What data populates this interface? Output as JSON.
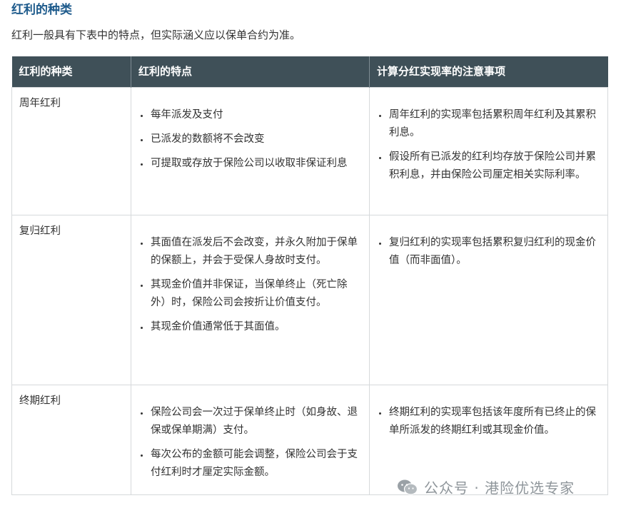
{
  "section_title": "红利的种类",
  "intro": "红利一般具有下表中的特点，但实际涵义应以保单合约为准。",
  "table": {
    "headers": [
      "红利的种类",
      "红利的特点",
      "计算分红实现率的注意事项"
    ],
    "rows": [
      {
        "type": "周年红利",
        "features": [
          "每年派发及支付",
          "已派发的数额将不会改变",
          "可提取或存放于保险公司以收取非保证利息"
        ],
        "notes": [
          "周年红利的实现率包括累积周年红利及其累积利息。",
          "假设所有已派发的红利均存放于保险公司并累积利息，并由保险公司厘定相关实际利率。"
        ]
      },
      {
        "type": "复归红利",
        "features": [
          "其面值在派发后不会改变，并永久附加于保单的保额上，并会于受保人身故时支付。",
          "其现金价值并非保证，当保单终止（死亡除外）时，保险公司会按折让价值支付。",
          "其现金价值通常低于其面值。"
        ],
        "notes": [
          "复归红利的实现率包括累积复归红利的现金价值（而非面值）。"
        ]
      },
      {
        "type": "终期红利",
        "features": [
          "保险公司会一次过于保单终止时（如身故、退保或保单期满）支付。",
          "每次公布的金额可能会调整，保险公司会于支付红利时才厘定实际金额。"
        ],
        "notes": [
          "终期红利的实现率包括该年度所有已终止的保单所派发的终期红利或其现金价值。"
        ]
      }
    ]
  },
  "watermark": {
    "icon": "wechat-icon",
    "text": "公众号 · 港险优选专家"
  }
}
